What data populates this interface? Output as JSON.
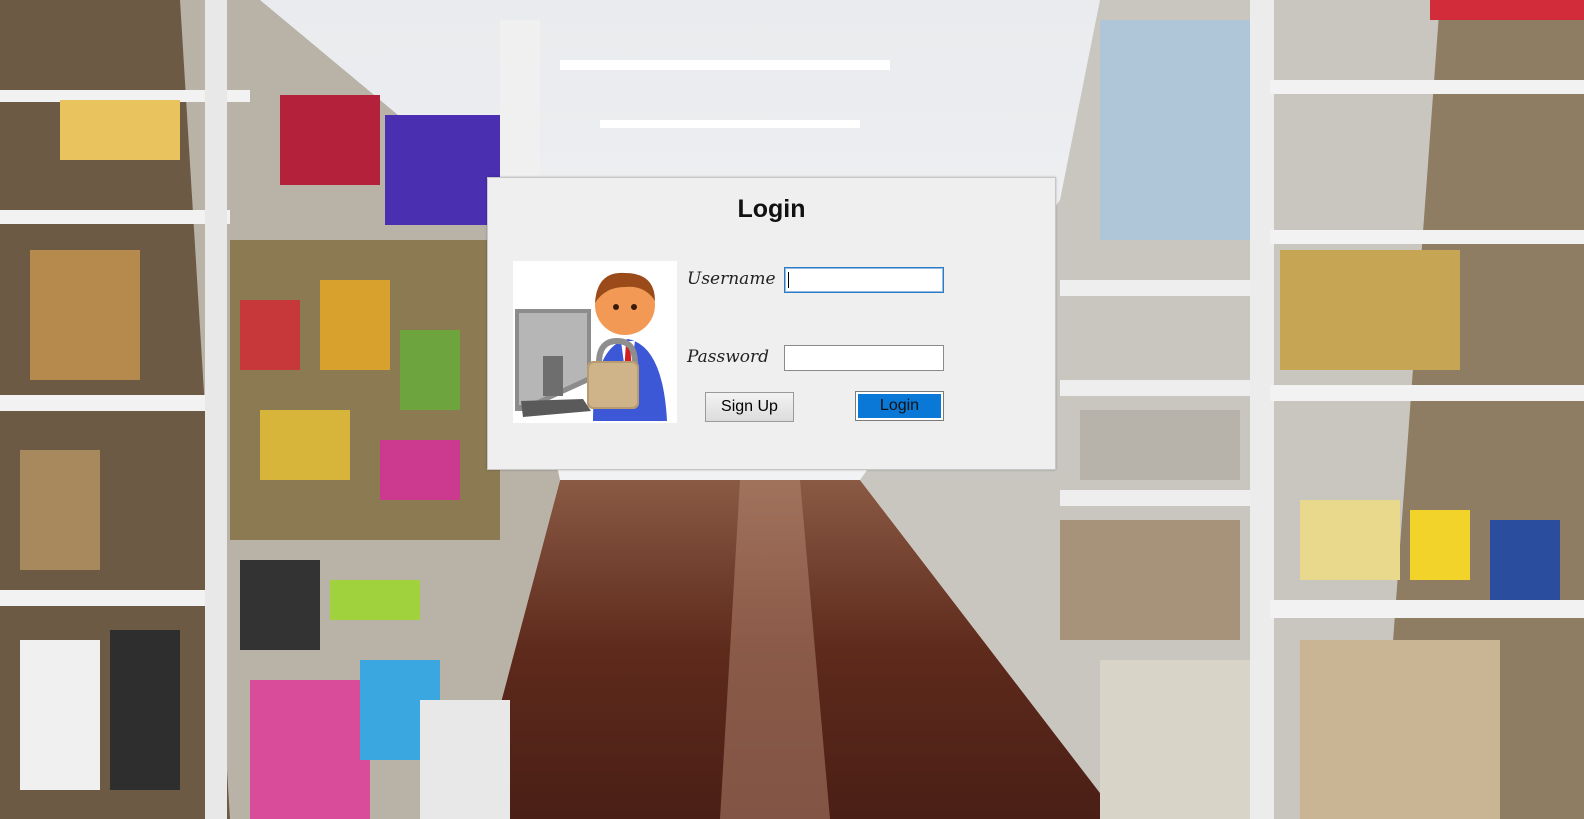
{
  "dialog": {
    "title": "Login",
    "username_label": "Username",
    "password_label": "Password",
    "username_value": "",
    "password_value": "",
    "signup_label": "Sign Up",
    "login_label": "Login"
  },
  "background": {
    "description_icon": "store-aisle-background"
  },
  "colors": {
    "login_button": "#0a78d7",
    "dialog_bg": "#efefef",
    "focus_border": "#2f7ac0"
  }
}
